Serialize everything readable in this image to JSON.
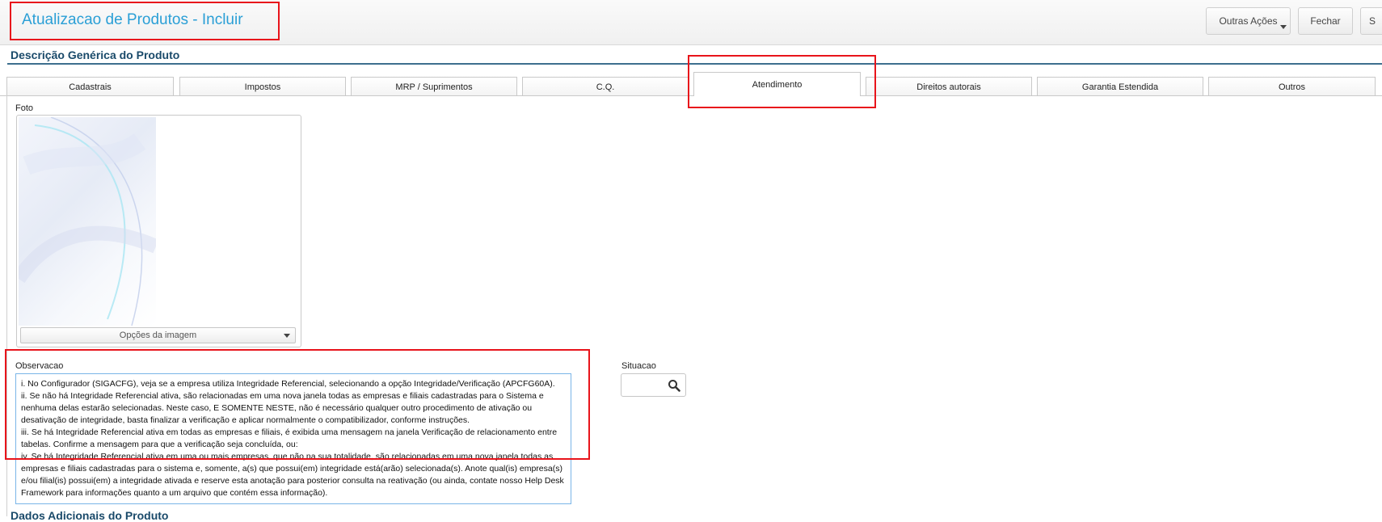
{
  "header": {
    "title": "Atualizacao de Produtos - Incluir",
    "buttons": {
      "outras_acoes": "Outras Ações",
      "fechar": "Fechar",
      "salvar_partial": "S"
    }
  },
  "section": {
    "title": "Descrição Genérica do Produto",
    "footer_title": "Dados Adicionais do Produto"
  },
  "tabs": [
    {
      "label": "Cadastrais"
    },
    {
      "label": "Impostos"
    },
    {
      "label": "MRP / Suprimentos"
    },
    {
      "label": "C.Q."
    },
    {
      "label": "Atendimento"
    },
    {
      "label": "Direitos autorais"
    },
    {
      "label": "Garantia Estendida"
    },
    {
      "label": "Outros"
    }
  ],
  "active_tab": "Atendimento",
  "foto": {
    "label": "Foto",
    "options_label": "Opções da imagem"
  },
  "observacao": {
    "label": "Observacao",
    "lines": [
      "i. No Configurador (SIGACFG), veja se a empresa utiliza Integridade Referencial, selecionando a opção Integridade/Verificação (APCFG60A).",
      "ii. Se não há Integridade Referencial ativa, são relacionadas em uma nova janela todas as empresas e filiais cadastradas para o Sistema e nenhuma delas estarão selecionadas. Neste caso, E SOMENTE NESTE, não é necessário qualquer outro procedimento de ativação ou desativação de integridade, basta finalizar a verificação e aplicar normalmente o compatibilizador, conforme instruções.",
      "iii. Se há Integridade Referencial ativa em todas as empresas e filiais, é exibida uma mensagem na janela Verificação de relacionamento entre tabelas. Confirme a mensagem para que a verificação seja concluída, ou:",
      "iv. Se há Integridade Referencial ativa em uma ou mais empresas, que não na sua totalidade, são relacionadas em uma nova janela todas as empresas e filiais cadastradas para o sistema e, somente, a(s) que possui(em) integridade está(arão) selecionada(s). Anote qual(is) empresa(s) e/ou filial(is) possui(em) a integridade ativada e reserve esta anotação para posterior consulta na reativação (ou ainda, contate nosso Help Desk Framework para informações quanto a um arquivo que contém essa informação)."
    ]
  },
  "situacao": {
    "label": "Situacao",
    "value": ""
  },
  "colors": {
    "title_blue": "#2a9fd6",
    "section_blue": "#1a4a6a",
    "highlight_red": "#e8141b"
  }
}
